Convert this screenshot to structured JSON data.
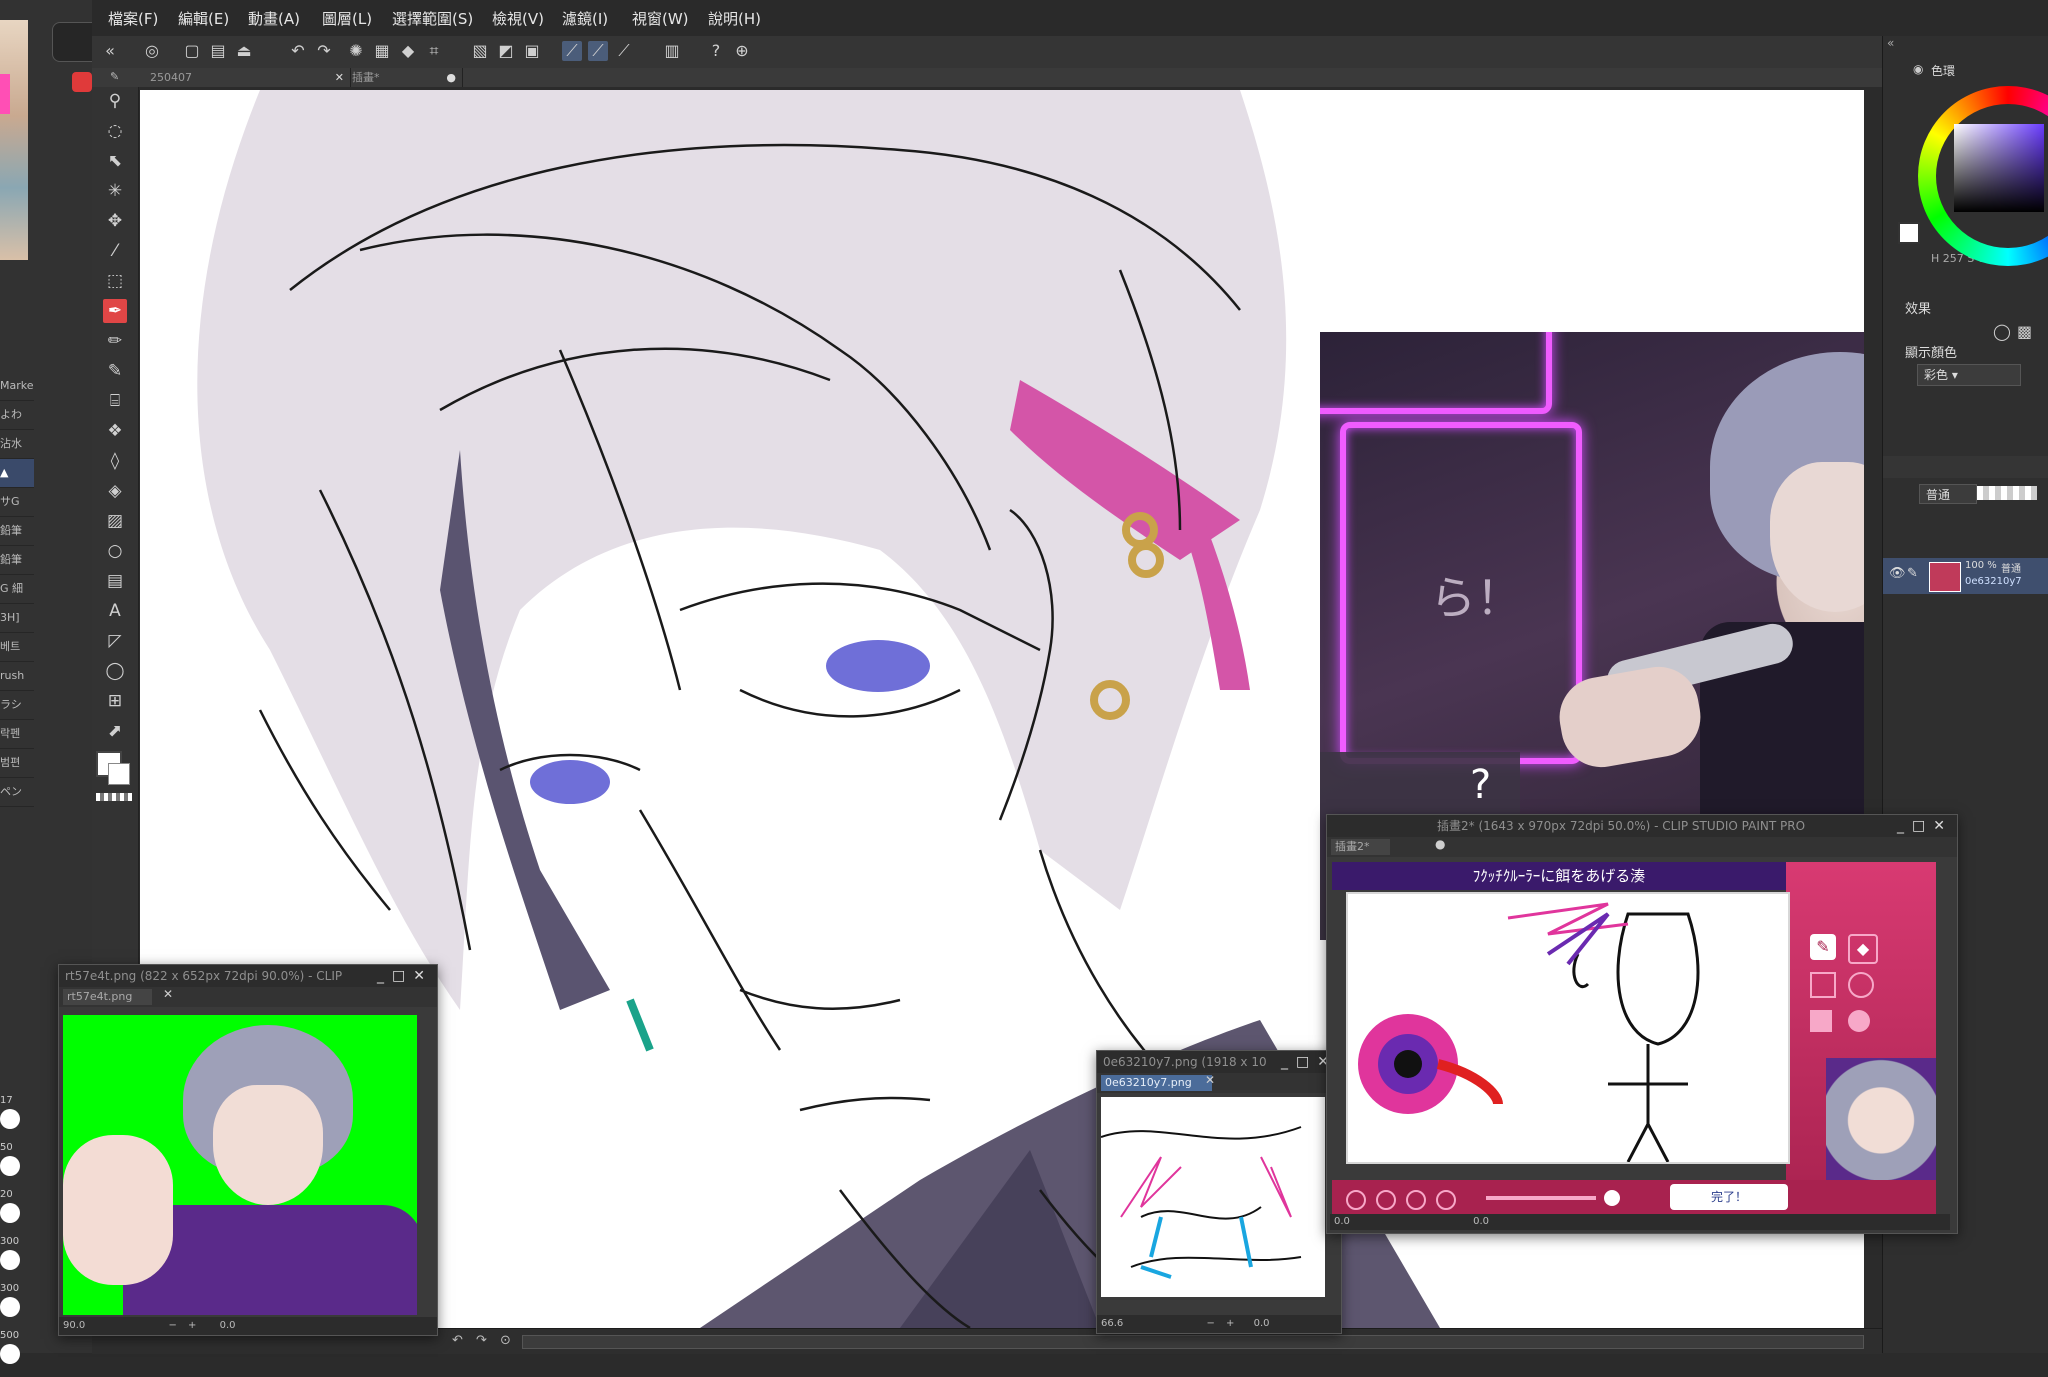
{
  "menu": [
    "檔案(F)",
    "編輯(E)",
    "動畫(A)",
    "圖層(L)",
    "選擇範圍(S)",
    "檢視(V)",
    "濾鏡(I)",
    "視窗(W)",
    "說明(H)"
  ],
  "doc_tabs": [
    "250407",
    "插畫*"
  ],
  "left_brushes": [
    "Marke",
    "よわ",
    "沾水",
    "▲",
    "サG",
    "鉛筆",
    "鉛筆",
    "G 細",
    "3H]",
    "베트",
    "rush",
    "ラシ",
    "락펜",
    "범편",
    "ペン"
  ],
  "left_sizes": [
    "17",
    "50",
    "20",
    "300",
    "300",
    "500"
  ],
  "right_panel": {
    "color_tab": "色環",
    "hsv_readout": "H 257 S 0 V",
    "effects_label": "效果",
    "display_color_label": "顯示顏色",
    "display_color_value": "彩色",
    "blend_mode": "普通",
    "layer_opacity": "100 %",
    "layer_blend": "普通",
    "layer_name": "0e63210y7"
  },
  "windows": {
    "rt57": {
      "title": "rt57e4t.png (822 x 652px 72dpi 90.0%) - CLIP",
      "tab": "rt57e4t.png",
      "zoom": "90.0",
      "rotation": "0.0"
    },
    "photo0e": {
      "title": "0e63210y7.png (1918 x 10",
      "tab": "0e63210y7.png",
      "zoom": "66.6",
      "rotation": "0.0"
    },
    "game": {
      "title": "插畫2* (1643 x 970px 72dpi 50.0%) - CLIP STUDIO PAINT PRO",
      "tab": "插畫2*",
      "banner": "ﾌｸｯﾁｸﾙｰﾗｰに餌をあげる湊",
      "done": "完了！",
      "zoom": "0.0",
      "rotation": "0.0"
    }
  },
  "canvas": {
    "question_mark": "?",
    "neon_text": "ら！"
  },
  "colors": {
    "accent_tool": "#e04646",
    "tab_highlight": "#4b6c9a",
    "neon": "#f05cff",
    "green_screen": "#00ff00",
    "game_banner": "#3a1a6b",
    "game_side": "#d83a72"
  }
}
